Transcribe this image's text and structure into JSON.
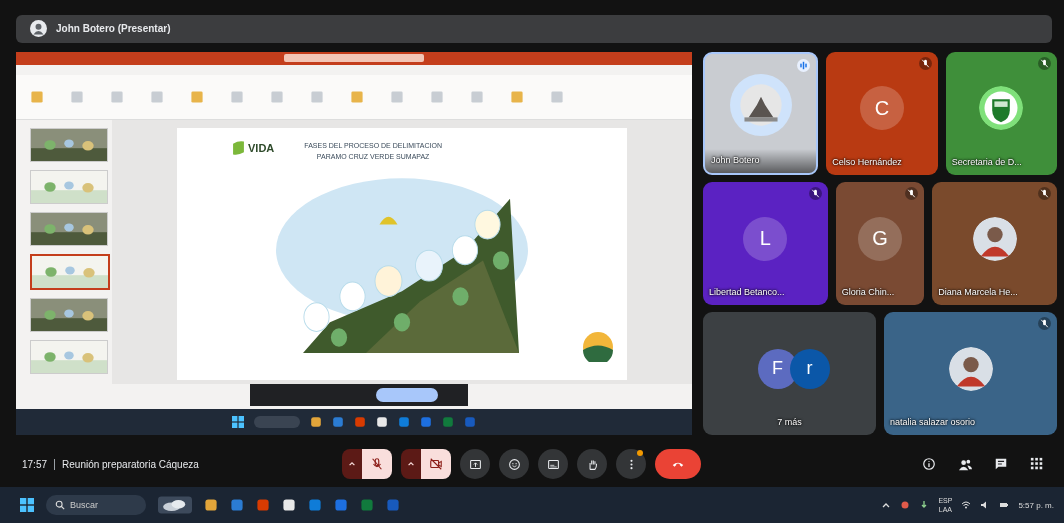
{
  "presenter_bar": {
    "label": "John Botero (Presentar)"
  },
  "shared_screen": {
    "thumbnails": [
      {
        "selected": false
      },
      {
        "selected": false
      },
      {
        "selected": false
      },
      {
        "selected": true
      },
      {
        "selected": false
      },
      {
        "selected": false
      }
    ],
    "slide": {
      "logo_text": "VIDA",
      "title": [
        "FASES DEL PROCESO DE DELIMITACION",
        "PARAMO CRUZ VERDE SUMAPAZ"
      ]
    }
  },
  "tiles": [
    {
      "name": "John Botero",
      "color": "#c9ccd1",
      "speaking": true,
      "muted": false
    },
    {
      "name": "Celso Hernández",
      "kind": "initial",
      "initial": "C",
      "color": "#b93a12",
      "speaking": false,
      "muted": true
    },
    {
      "name": "Secretaria de D...",
      "kind": "emblem",
      "color": "#3f8f3a",
      "speaking": false,
      "muted": true
    },
    {
      "name": "Libertad Betanco...",
      "kind": "initial",
      "initial": "L",
      "color": "#5b22c2",
      "speaking": false,
      "muted": true
    },
    {
      "name": "Gloria Chin...",
      "kind": "initial",
      "initial": "G",
      "color": "#7a4a33",
      "speaking": false,
      "muted": true
    },
    {
      "name": "Diana Marcela He...",
      "kind": "silhouette",
      "color": "#7a4a2c",
      "speaking": false,
      "muted": true
    },
    {
      "name": "7 más",
      "kind": "overflow",
      "initials": [
        {
          "letter": "F",
          "color": "#5c6bc0"
        },
        {
          "letter": "r",
          "color": "#0b57a8"
        }
      ],
      "color": "#3c4043",
      "speaking": false,
      "muted": false
    },
    {
      "name": "natalia salazar osorio",
      "kind": "silhouette",
      "color": "#3a6488",
      "speaking": false,
      "muted": true
    }
  ],
  "meeting": {
    "time": "17:57",
    "title": "Reunión preparatoria Cáqueza"
  },
  "controls": [
    {
      "kind": "mic",
      "off": true
    },
    {
      "kind": "camera",
      "off": true
    },
    {
      "kind": "present"
    },
    {
      "kind": "emoji"
    },
    {
      "kind": "captions"
    },
    {
      "kind": "hand"
    },
    {
      "kind": "more",
      "badge": true
    },
    {
      "kind": "end"
    }
  ],
  "side_controls": [
    {
      "kind": "info"
    },
    {
      "kind": "people"
    },
    {
      "kind": "chat"
    },
    {
      "kind": "activities"
    }
  ],
  "taskbar": {
    "search_placeholder": "Buscar",
    "language": [
      "ESP",
      "LAA"
    ],
    "time": "5:57 p. m."
  }
}
